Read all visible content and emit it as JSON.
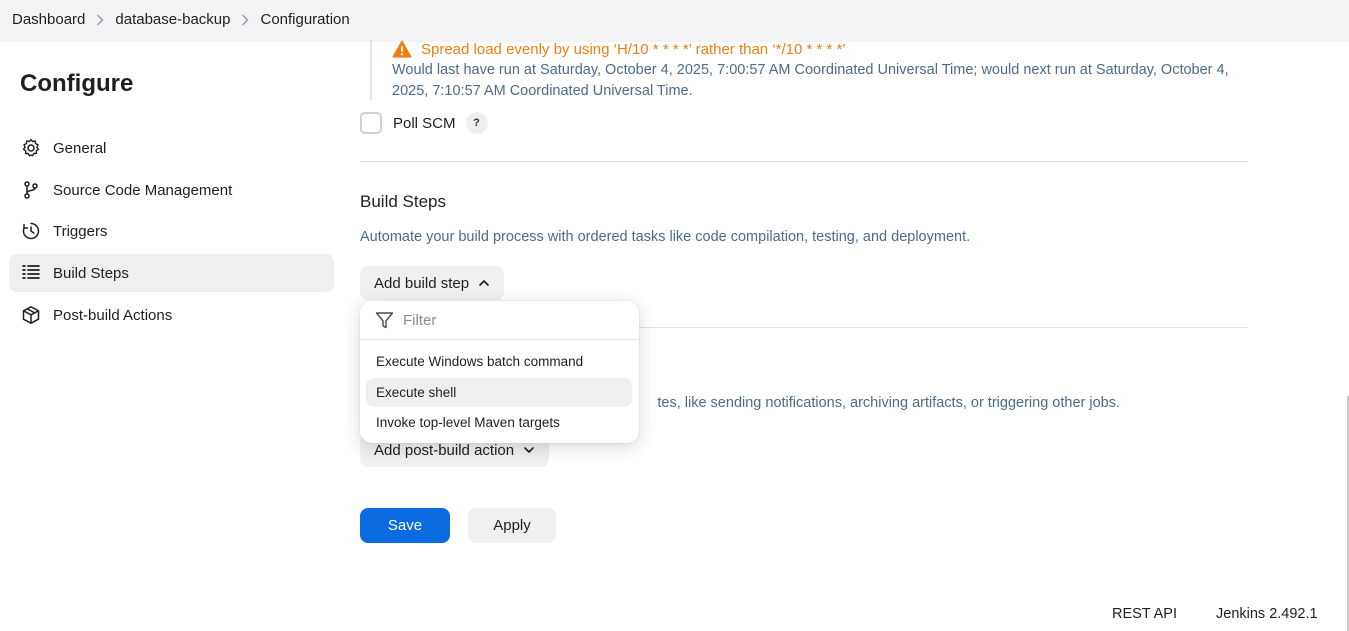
{
  "breadcrumb": {
    "items": [
      "Dashboard",
      "database-backup",
      "Configuration"
    ]
  },
  "sidebar": {
    "title": "Configure",
    "items": [
      {
        "label": "General",
        "icon": "gear-icon"
      },
      {
        "label": "Source Code Management",
        "icon": "branch-icon"
      },
      {
        "label": "Triggers",
        "icon": "clock-icon"
      },
      {
        "label": "Build Steps",
        "icon": "list-icon",
        "active": true
      },
      {
        "label": "Post-build Actions",
        "icon": "package-icon"
      }
    ]
  },
  "triggers": {
    "warning": "Spread load evenly by using ‘H/10 * * * *’ rather than ‘*/10 * * * *’",
    "run_info": "Would last have run at Saturday, October 4, 2025, 7:00:57 AM Coordinated Universal Time; would next run at Saturday, October 4, 2025, 7:10:57 AM Coordinated Universal Time.",
    "poll_scm_label": "Poll SCM",
    "poll_scm_checked": false,
    "help_label": "?"
  },
  "build_steps": {
    "title": "Build Steps",
    "description": "Automate your build process with ordered tasks like code compilation, testing, and deployment.",
    "add_button": "Add build step"
  },
  "dropdown": {
    "filter_placeholder": "Filter",
    "filter_value": "",
    "items": [
      "Execute Windows batch command",
      "Execute shell",
      "Invoke top-level Maven targets"
    ],
    "highlighted": "Execute shell"
  },
  "post_build": {
    "description_visible": "tes, like sending notifications, archiving artifacts, or triggering other jobs.",
    "add_button": "Add post-build action"
  },
  "actions": {
    "save": "Save",
    "apply": "Apply"
  },
  "footer": {
    "rest_api": "REST API",
    "version": "Jenkins 2.492.1"
  },
  "colors": {
    "primary": "#0a6ce0",
    "warning": "#f07f12",
    "muted_text": "#4e6a89",
    "active_bg": "#efeff2"
  }
}
